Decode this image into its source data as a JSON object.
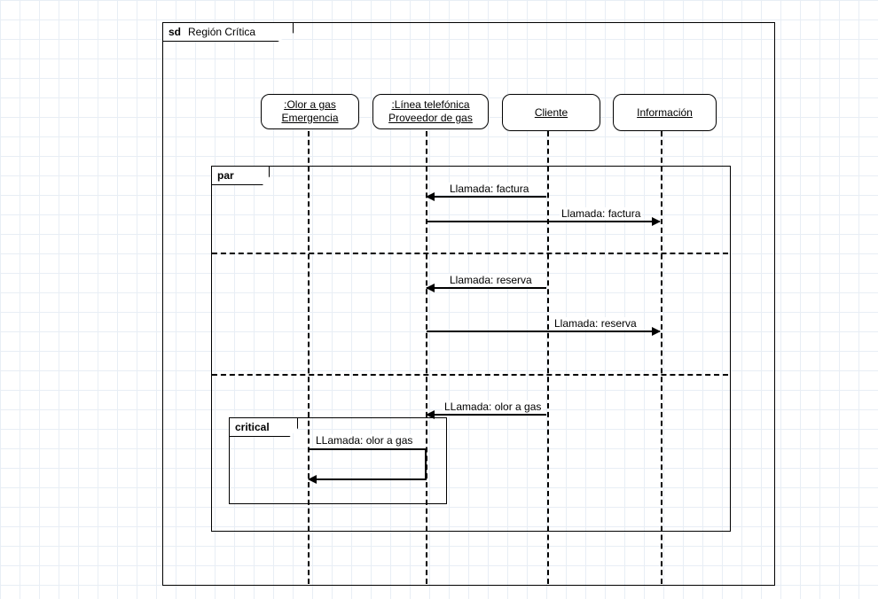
{
  "frame": {
    "sd_prefix": "sd",
    "title": "Región Crítica"
  },
  "lifelines": {
    "l1": {
      "line1": ":Olor a gas",
      "line2": "Emergencia"
    },
    "l2": {
      "line1": ":Línea telefónica",
      "line2": "Proveedor de gas"
    },
    "l3": {
      "line1": "Cliente"
    },
    "l4": {
      "line1": "Información"
    }
  },
  "fragments": {
    "par": "par",
    "critical": "critical"
  },
  "messages": {
    "m1": "Llamada: factura",
    "m2": "Llamada: factura",
    "m3": "Llamada: reserva",
    "m4": "Llamada: reserva",
    "m5": "LLamada: olor a gas",
    "m6": "LLamada: olor a gas"
  }
}
